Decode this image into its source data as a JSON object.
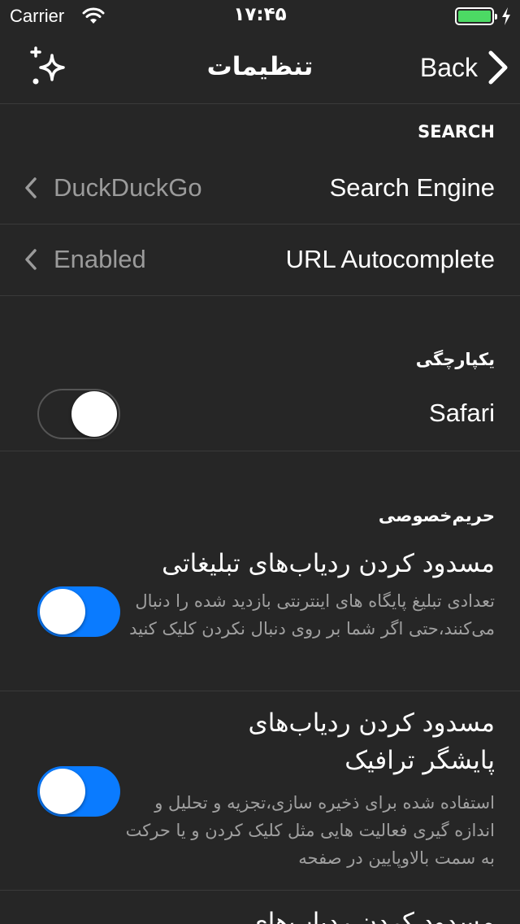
{
  "status_bar": {
    "carrier": "Carrier",
    "time": "۱۷:۴۵",
    "battery_color": "#4cd964"
  },
  "nav": {
    "title": "تنظیمات",
    "back_label": "Back",
    "left_icon": "sparkle-icon"
  },
  "search_section": {
    "header": "SEARCH",
    "rows": [
      {
        "label": "Search Engine",
        "value": "DuckDuckGo"
      },
      {
        "label": "URL Autocomplete",
        "value": "Enabled"
      }
    ]
  },
  "integration_section": {
    "header": "یکپارچگی",
    "safari_label": "Safari",
    "safari_enabled": false
  },
  "privacy_section": {
    "header": "حریم‌خصوصی",
    "items": [
      {
        "title": "مسدود کردن ردیاب‌های تبلیغاتی",
        "description": "تعدادی تبلیغ پایگاه های اینترنتی بازدید شده را دنبال می‌کنند،حتی اگر شما بر روی دنبال نکردن کلیک کنید",
        "enabled": false
      },
      {
        "title": "مسدود کردن ردیاب‌های پایشگر ترافیک",
        "description": "استفاده شده برای ذخیره سازی،تجزیه و تحلیل و اندازه گیری فعالیت هایی مثل کلیک کردن و یا حرکت به سمت بالاوپایین در صفحه",
        "enabled": false
      },
      {
        "title": "مسدود کردن ردیاب‌های"
      }
    ]
  },
  "colors": {
    "background": "#262626",
    "separator": "#3a3a3a",
    "accent": "#0a7bff",
    "secondary_text": "#9b9b9b"
  }
}
